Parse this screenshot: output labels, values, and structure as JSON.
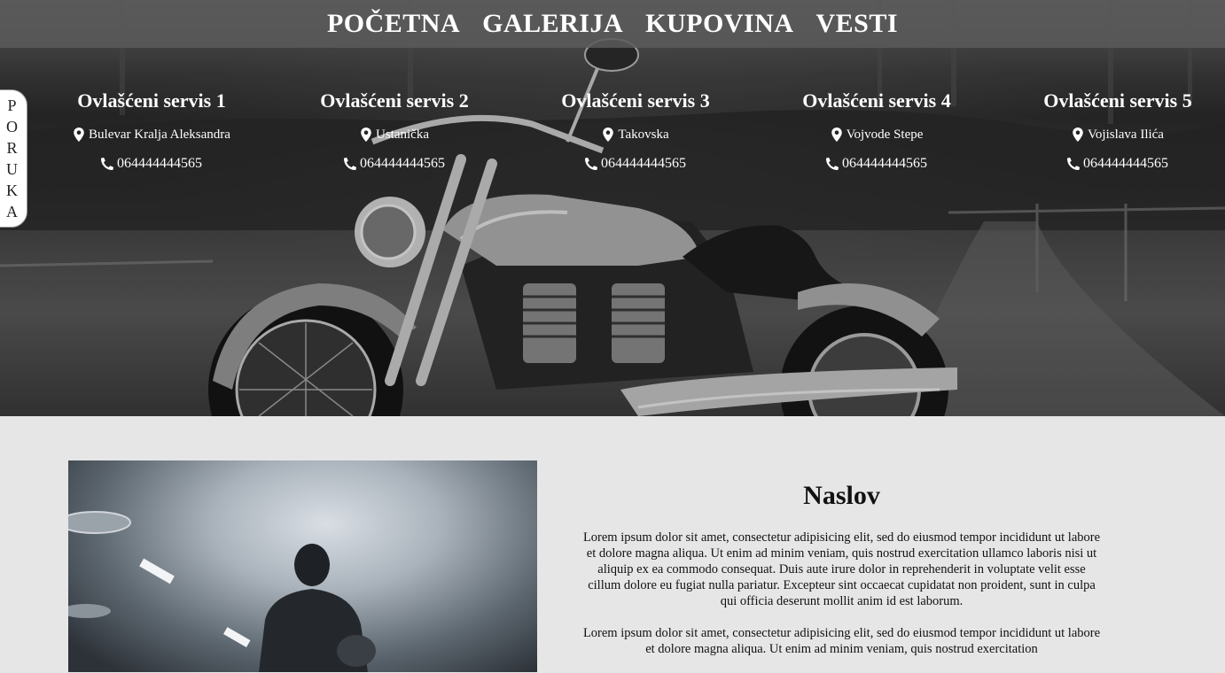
{
  "nav": {
    "items": [
      "POČETNA",
      "GALERIJA",
      "KUPOVINA",
      "VESTI"
    ]
  },
  "side_tab": {
    "letters": [
      "P",
      "O",
      "R",
      "U",
      "K",
      "A"
    ]
  },
  "services": [
    {
      "name": "Ovlašćeni servis 1",
      "address": "Bulevar Kralja Aleksandra",
      "phone": "064444444565"
    },
    {
      "name": "Ovlašćeni servis 2",
      "address": "Ustanička",
      "phone": "064444444565"
    },
    {
      "name": "Ovlašćeni servis 3",
      "address": "Takovska",
      "phone": "064444444565"
    },
    {
      "name": "Ovlašćeni servis 4",
      "address": "Vojvode Stepe",
      "phone": "064444444565"
    },
    {
      "name": "Ovlašćeni servis 5",
      "address": "Vojislava Ilića",
      "phone": "064444444565"
    }
  ],
  "icons": {
    "address": "map-marker-icon",
    "phone": "phone-icon"
  },
  "article": {
    "title": "Naslov",
    "paragraphs": [
      "Lorem ipsum dolor sit amet, consectetur adipisicing elit, sed do eiusmod tempor incididunt ut labore et dolore magna aliqua. Ut enim ad minim veniam, quis nostrud exercitation ullamco laboris nisi ut aliquip ex ea commodo consequat. Duis aute irure dolor in reprehenderit in voluptate velit esse cillum dolore eu fugiat nulla pariatur. Excepteur sint occaecat cupidatat non proident, sunt in culpa qui officia deserunt mollit anim id est laborum.",
      "Lorem ipsum dolor sit amet, consectetur adipisicing elit, sed do eiusmod tempor incididunt ut labore et dolore magna aliqua. Ut enim ad minim veniam, quis nostrud exercitation"
    ]
  },
  "colors": {
    "page_bg": "#e6e6e6",
    "nav_bg": "#5a5a5a",
    "text_light": "#ffffff"
  }
}
